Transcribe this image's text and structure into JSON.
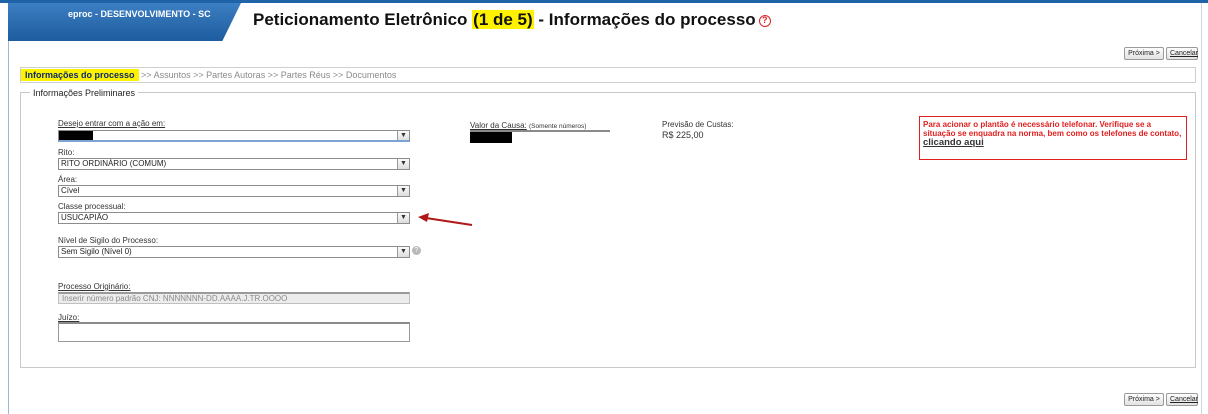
{
  "header": {
    "brand": "eproc - DESENVOLVIMENTO - SC",
    "title_before": "Peticionamento Eletrônico ",
    "title_highlight": "(1 de 5)",
    "title_after": " - Informações do processo",
    "help_glyph": "?"
  },
  "actions": {
    "next_label": "Próxima >",
    "cancel_label": "Cancelar"
  },
  "steps": [
    {
      "label": "Informações do processo",
      "active": true
    },
    {
      "label": "Assuntos",
      "active": false
    },
    {
      "label": "Partes Autoras",
      "active": false
    },
    {
      "label": "Partes Réus",
      "active": false
    },
    {
      "label": "Documentos",
      "active": false
    }
  ],
  "step_separator": ">>",
  "form": {
    "legend": "Informações Preliminares",
    "desejo_label": "Desejo entrar com a ação em:",
    "rito_label": "Rito:",
    "rito_value": "RITO ORDINÁRIO (COMUM)",
    "area_label": "Área:",
    "area_value": "Cível",
    "classe_label": "Classe processual:",
    "classe_value": "USUCAPIÃO",
    "sigilo_label": "Nível de Sigilo do Processo:",
    "sigilo_value": "Sem Sigilo (Nível 0)",
    "processo_label": "Processo Originário:",
    "processo_placeholder": "Inserir número padrão CNJ:  NNNNNNN-DD.AAAA.J.TR.OOOO",
    "juizo_label": "Juízo:",
    "valor_label": "Valor da Causa:",
    "valor_hint": "(Somente números)",
    "previsao_label": "Previsão de Custas:",
    "previsao_value": "R$ 225,00",
    "select_arrow": "▼"
  },
  "notice": {
    "text": "Para acionar o plantão é necessário telefonar. Verifique se a situação se enquadra na norma, bem como os telefones de contato, ",
    "link": "clicando aqui"
  },
  "colors": {
    "highlight": "#fff200",
    "brand_blue": "#1f64a8",
    "alert_red": "#e02020",
    "arrow_red": "#b01818"
  }
}
